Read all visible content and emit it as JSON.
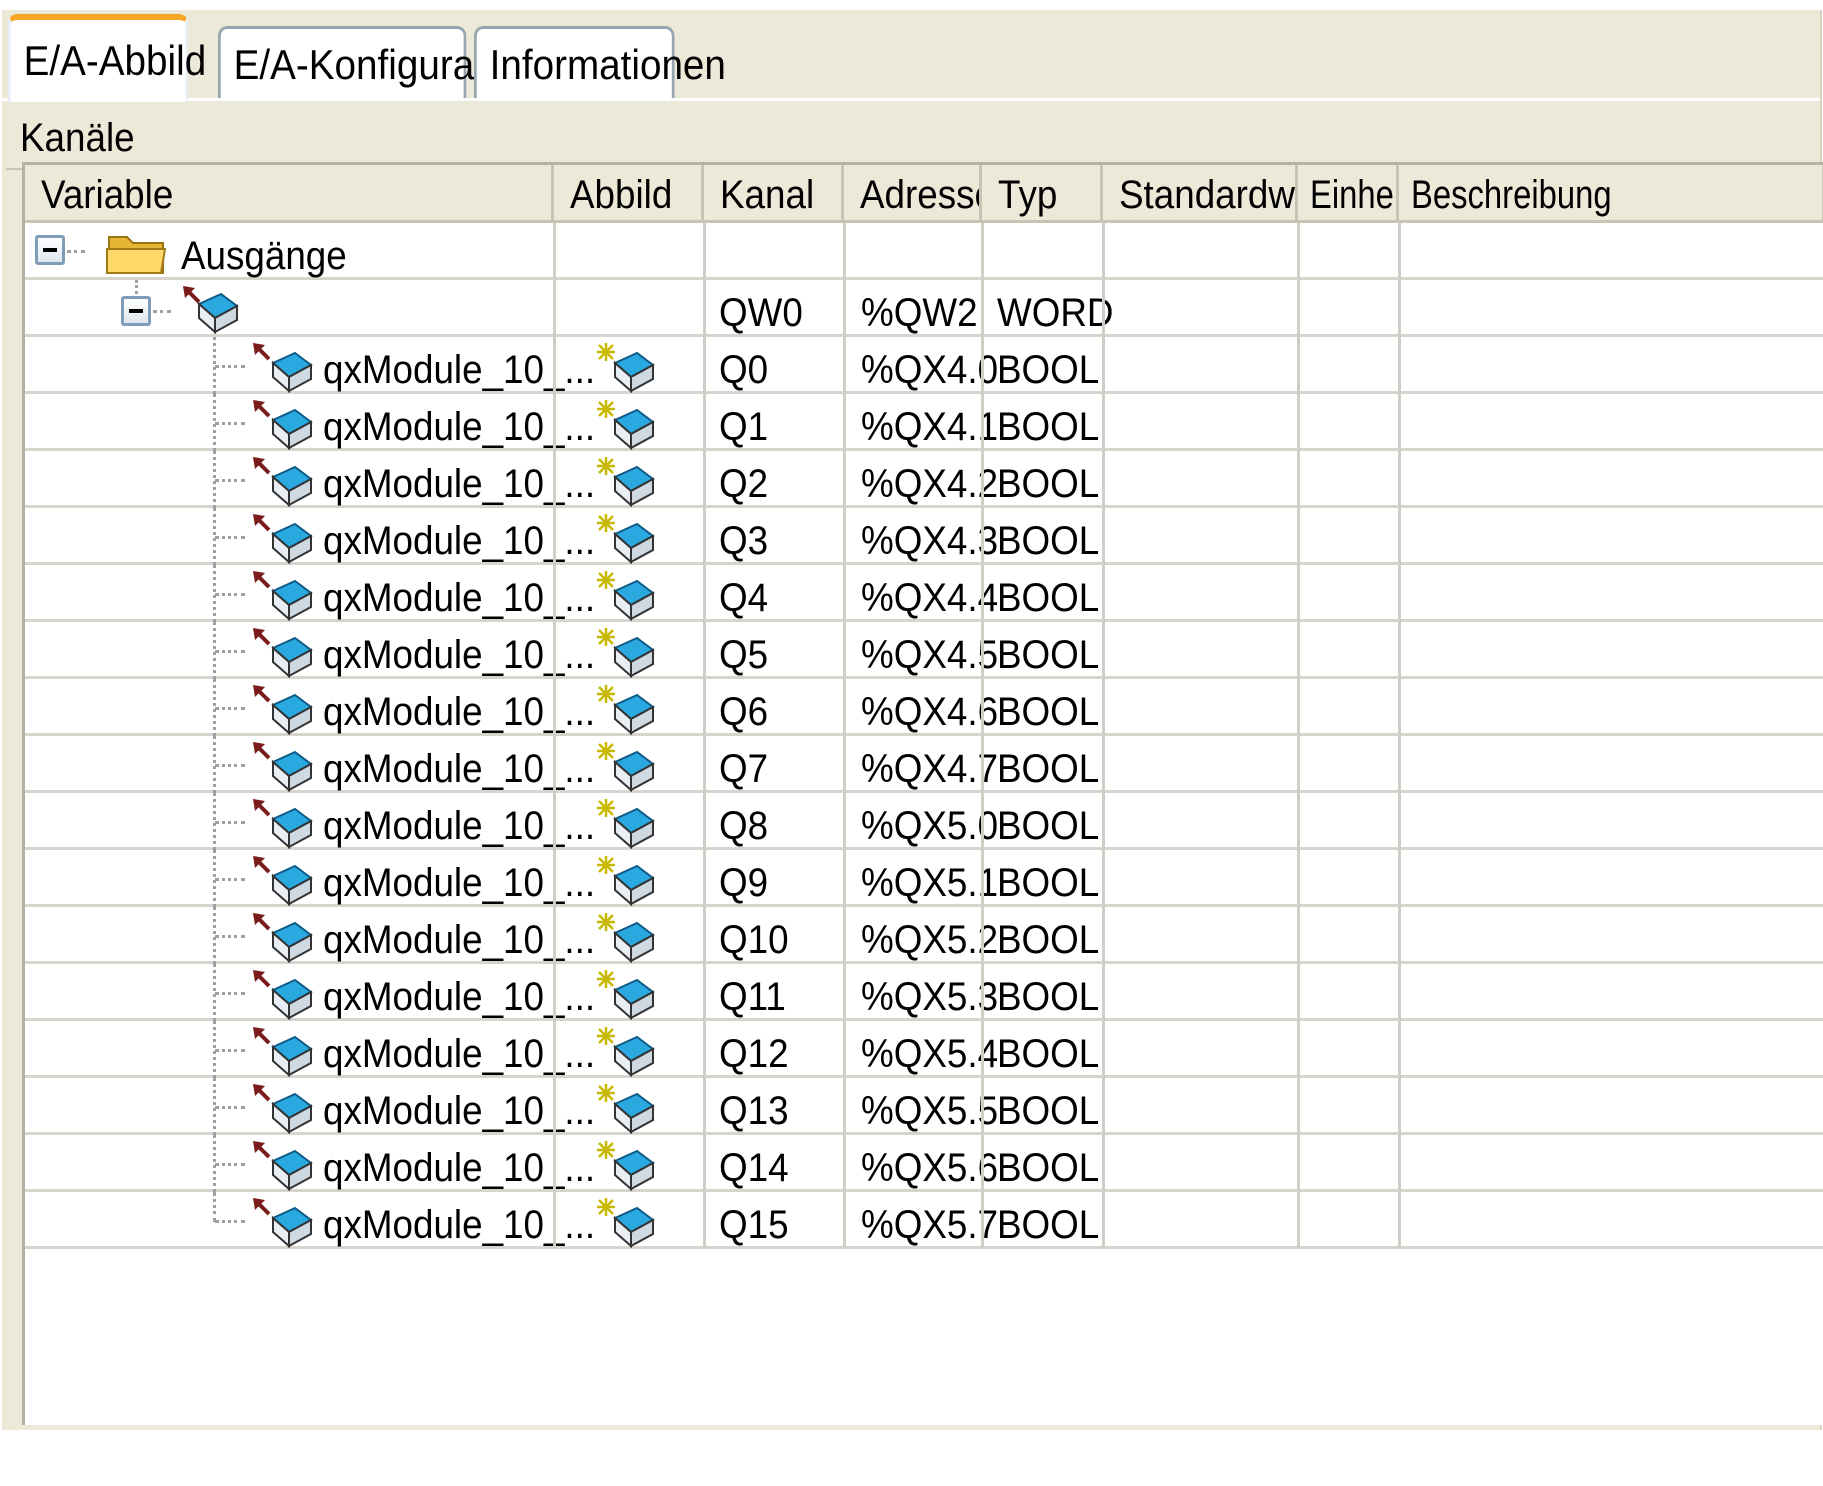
{
  "tabs": [
    {
      "label": "E/A-Abbild",
      "active": true
    },
    {
      "label": "E/A-Konfiguration",
      "active": false
    },
    {
      "label": "Informationen",
      "active": false
    }
  ],
  "section_label": "Kanäle",
  "columns": [
    "Variable",
    "Abbild",
    "Kanal",
    "Adresse",
    "Typ",
    "Standardwert",
    "Einheit",
    "Beschreibung"
  ],
  "folder": {
    "label": "Ausgänge",
    "icon": "folder-icon"
  },
  "word_row": {
    "variable": "",
    "kanal": "QW0",
    "adresse": "%QW2",
    "typ": "WORD"
  },
  "rows": [
    {
      "variable": "qxModule_10_...",
      "kanal": "Q0",
      "adresse": "%QX4.0",
      "typ": "BOOL"
    },
    {
      "variable": "qxModule_10_...",
      "kanal": "Q1",
      "adresse": "%QX4.1",
      "typ": "BOOL"
    },
    {
      "variable": "qxModule_10_...",
      "kanal": "Q2",
      "adresse": "%QX4.2",
      "typ": "BOOL"
    },
    {
      "variable": "qxModule_10_...",
      "kanal": "Q3",
      "adresse": "%QX4.3",
      "typ": "BOOL"
    },
    {
      "variable": "qxModule_10_...",
      "kanal": "Q4",
      "adresse": "%QX4.4",
      "typ": "BOOL"
    },
    {
      "variable": "qxModule_10_...",
      "kanal": "Q5",
      "adresse": "%QX4.5",
      "typ": "BOOL"
    },
    {
      "variable": "qxModule_10_...",
      "kanal": "Q6",
      "adresse": "%QX4.6",
      "typ": "BOOL"
    },
    {
      "variable": "qxModule_10_...",
      "kanal": "Q7",
      "adresse": "%QX4.7",
      "typ": "BOOL"
    },
    {
      "variable": "qxModule_10_...",
      "kanal": "Q8",
      "adresse": "%QX5.0",
      "typ": "BOOL"
    },
    {
      "variable": "qxModule_10_...",
      "kanal": "Q9",
      "adresse": "%QX5.1",
      "typ": "BOOL"
    },
    {
      "variable": "qxModule_10_...",
      "kanal": "Q10",
      "adresse": "%QX5.2",
      "typ": "BOOL"
    },
    {
      "variable": "qxModule_10_...",
      "kanal": "Q11",
      "adresse": "%QX5.3",
      "typ": "BOOL"
    },
    {
      "variable": "qxModule_10_...",
      "kanal": "Q12",
      "adresse": "%QX5.4",
      "typ": "BOOL"
    },
    {
      "variable": "qxModule_10_...",
      "kanal": "Q13",
      "adresse": "%QX5.5",
      "typ": "BOOL"
    },
    {
      "variable": "qxModule_10_...",
      "kanal": "Q14",
      "adresse": "%QX5.6",
      "typ": "BOOL"
    },
    {
      "variable": "qxModule_10_...",
      "kanal": "Q15",
      "adresse": "%QX5.7",
      "typ": "BOOL"
    }
  ],
  "colors": {
    "active_tab_accent": "#f5a623",
    "panel_bg": "#ece9d8",
    "cube_blue": "#1b9ad6",
    "output_arrow": "#7a1c1c"
  }
}
